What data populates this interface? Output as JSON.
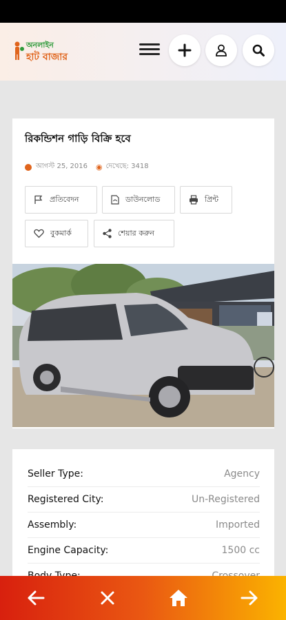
{
  "header": {
    "logo_line1": "অনলাইন",
    "logo_line2": "হাট বাজার",
    "icons": [
      "menu-icon",
      "plus-icon",
      "user-icon",
      "search-icon"
    ]
  },
  "listing": {
    "title": "রিকন্ডিশন গাড়ি বিক্রি হবে",
    "date": "আগস্ট 25, 2016",
    "views": "দেখেছে: 3418",
    "actions": {
      "report": "প্রতিবেদন",
      "download": "ডাউনলোড",
      "print": "প্রিন্ট",
      "bookmark": "বুকমার্ক",
      "share": "শেয়ার করুন"
    }
  },
  "details": [
    {
      "label": "Seller Type:",
      "value": "Agency"
    },
    {
      "label": "Registered City:",
      "value": "Un-Registered"
    },
    {
      "label": "Assembly:",
      "value": "Imported"
    },
    {
      "label": "Engine Capacity:",
      "value": "1500 cc"
    },
    {
      "label": "Body Type:",
      "value": "Crossover"
    }
  ],
  "bottom_nav": [
    "arrow-left-icon",
    "close-icon",
    "home-icon",
    "arrow-right-icon"
  ],
  "colors": {
    "accent": "#e0641c",
    "nav_start": "#d8200e",
    "nav_end": "#fbb300"
  }
}
